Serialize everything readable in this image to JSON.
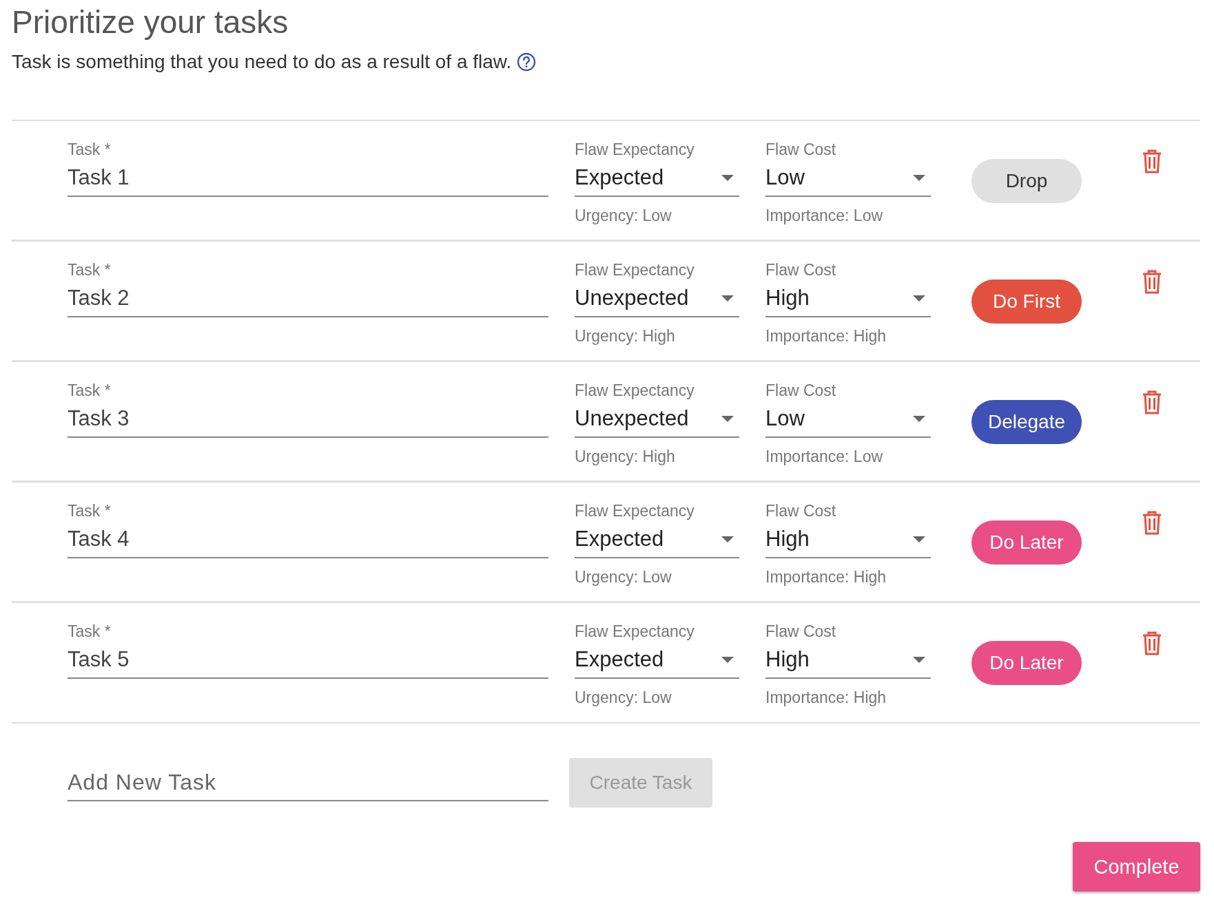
{
  "header": {
    "title": "Prioritize your tasks",
    "subtitle": "Task is something that you need to do as a result of a flaw."
  },
  "tasks": [
    {
      "task_label": "Task *",
      "task": "Task 1",
      "expectancy": {
        "label": "Flaw Expectancy",
        "value": "Expected",
        "helper": "Urgency: Low"
      },
      "cost": {
        "label": "Flaw Cost",
        "value": "Low",
        "helper": "Importance: Low"
      },
      "action": {
        "label": "Drop",
        "color": "#e0e0e0"
      }
    },
    {
      "task_label": "Task *",
      "task": "Task 2",
      "expectancy": {
        "label": "Flaw Expectancy",
        "value": "Unexpected",
        "helper": "Urgency: High"
      },
      "cost": {
        "label": "Flaw Cost",
        "value": "High",
        "helper": "Importance: High"
      },
      "action": {
        "label": "Do First",
        "color": "#e2513f"
      }
    },
    {
      "task_label": "Task *",
      "task": "Task 3",
      "expectancy": {
        "label": "Flaw Expectancy",
        "value": "Unexpected",
        "helper": "Urgency: High"
      },
      "cost": {
        "label": "Flaw Cost",
        "value": "Low",
        "helper": "Importance: Low"
      },
      "action": {
        "label": "Delegate",
        "color": "#3f51b5"
      }
    },
    {
      "task_label": "Task *",
      "task": "Task 4",
      "expectancy": {
        "label": "Flaw Expectancy",
        "value": "Expected",
        "helper": "Urgency: Low"
      },
      "cost": {
        "label": "Flaw Cost",
        "value": "High",
        "helper": "Importance: High"
      },
      "action": {
        "label": "Do Later",
        "color": "#e94f85"
      }
    },
    {
      "task_label": "Task *",
      "task": "Task 5",
      "expectancy": {
        "label": "Flaw Expectancy",
        "value": "Expected",
        "helper": "Urgency: Low"
      },
      "cost": {
        "label": "Flaw Cost",
        "value": "High",
        "helper": "Importance: High"
      },
      "action": {
        "label": "Do Later",
        "color": "#e94f85"
      }
    }
  ],
  "new_task": {
    "placeholder": "Add New Task",
    "button": "Create Task",
    "disabled": true
  },
  "complete_button": "Complete"
}
